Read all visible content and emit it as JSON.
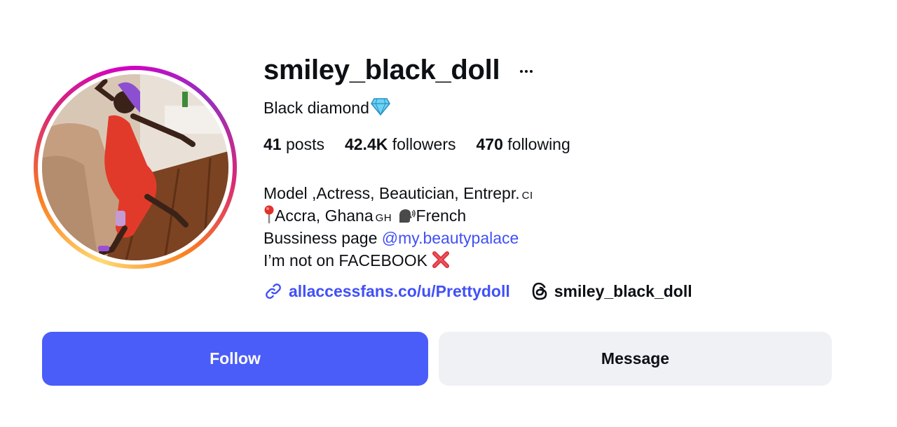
{
  "profile": {
    "username": "smiley_black_doll",
    "full_name": "Black diamond",
    "full_name_emoji": "gem-icon",
    "stats": {
      "posts_count": "41",
      "posts_label": "posts",
      "followers_count": "42.4K",
      "followers_label": "followers",
      "following_count": "470",
      "following_label": "following"
    },
    "bio": {
      "line1": "Model ,Actress, Beautician, Entrepr.",
      "line1_flag": "CI",
      "line2_prefix_icon": "round-pushpin-icon",
      "line2_location": "Accra, Ghana",
      "line2_flag": "GH",
      "line2_icon": "speaking-head-icon",
      "line2_language": "French",
      "line3_text": "Bussiness page",
      "line3_mention": "@my.beautypalace",
      "line4_text": "I’m not on FACEBOOK",
      "line4_icon": "cross-mark-icon"
    },
    "external_link": "allaccessfans.co/u/Prettydoll",
    "threads_handle": "smiley_black_doll"
  },
  "actions": {
    "follow_label": "Follow",
    "message_label": "Message"
  },
  "colors": {
    "accent": "#4a5df9",
    "link": "#4150f7",
    "secondary_button": "#eff1f5",
    "text": "#0c1014"
  }
}
